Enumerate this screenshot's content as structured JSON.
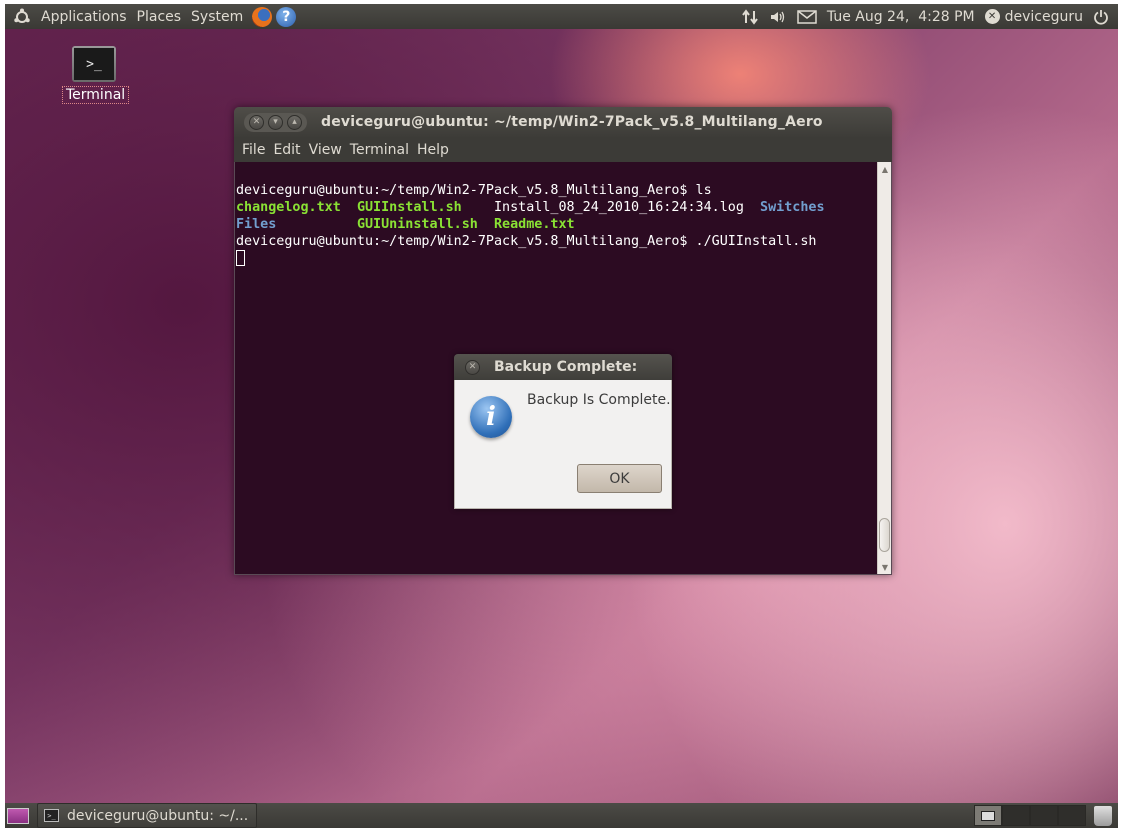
{
  "top_panel": {
    "menus": [
      "Applications",
      "Places",
      "System"
    ],
    "clock": "Tue Aug 24,  4:28 PM",
    "user": "deviceguru"
  },
  "desktop": {
    "terminal_icon_label": "Terminal"
  },
  "terminal": {
    "title": "deviceguru@ubuntu: ~/temp/Win2-7Pack_v5.8_Multilang_Aero",
    "menu": [
      "File",
      "Edit",
      "View",
      "Terminal",
      "Help"
    ],
    "lines": {
      "l1": "deviceguru@ubuntu:~/temp/Win2-7Pack_v5.8_Multilang_Aero$ ls",
      "f1": "changelog.txt",
      "f2": "GUIInstall.sh",
      "f3": "Install_08_24_2010_16:24:34.log",
      "f4": "Switches",
      "f5": "Files",
      "f6": "GUIUninstall.sh",
      "f7": "Readme.txt",
      "l3": "deviceguru@ubuntu:~/temp/Win2-7Pack_v5.8_Multilang_Aero$ ./GUIInstall.sh"
    }
  },
  "dialog": {
    "title": "Backup Complete:",
    "message": "Backup Is Complete.",
    "ok_label": "OK"
  },
  "bottom_panel": {
    "task_label": "deviceguru@ubuntu: ~/..."
  },
  "colors": {
    "terminal_bg": "#2c0b22",
    "exec_file": "#8ae234",
    "directory": "#729fcf",
    "panel": "#3c3b37"
  },
  "icons": [
    "ubuntu-logo-icon",
    "firefox-icon",
    "help-icon",
    "network-icon",
    "volume-icon",
    "mail-icon",
    "user-icon",
    "power-icon",
    "info-icon",
    "trash-icon"
  ]
}
